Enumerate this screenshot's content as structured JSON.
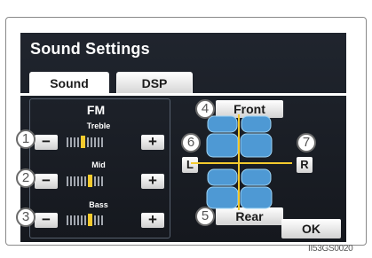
{
  "screen": {
    "title": "Sound Settings"
  },
  "tabs": [
    {
      "label": "Sound",
      "selected": true
    },
    {
      "label": "DSP",
      "selected": false
    }
  ],
  "sound_panel": {
    "mode": "FM",
    "controls": [
      {
        "label": "Treble",
        "minus": "−",
        "plus": "+",
        "level_index": 4,
        "segments": 10
      },
      {
        "label": "Mid",
        "minus": "−",
        "plus": "+",
        "level_index": 6,
        "segments": 10
      },
      {
        "label": "Bass",
        "minus": "−",
        "plus": "+",
        "level_index": 6,
        "segments": 10
      }
    ]
  },
  "balance": {
    "front": "Front",
    "rear": "Rear",
    "left": "L",
    "right": "R"
  },
  "ok_label": "OK",
  "callouts": [
    "1",
    "2",
    "3",
    "4",
    "5",
    "6",
    "7"
  ],
  "image_code": "II53GS0020",
  "colors": {
    "accent": "#f4ca2e",
    "seat": "#4e99d4",
    "screen_bg": "#1b1f26"
  }
}
